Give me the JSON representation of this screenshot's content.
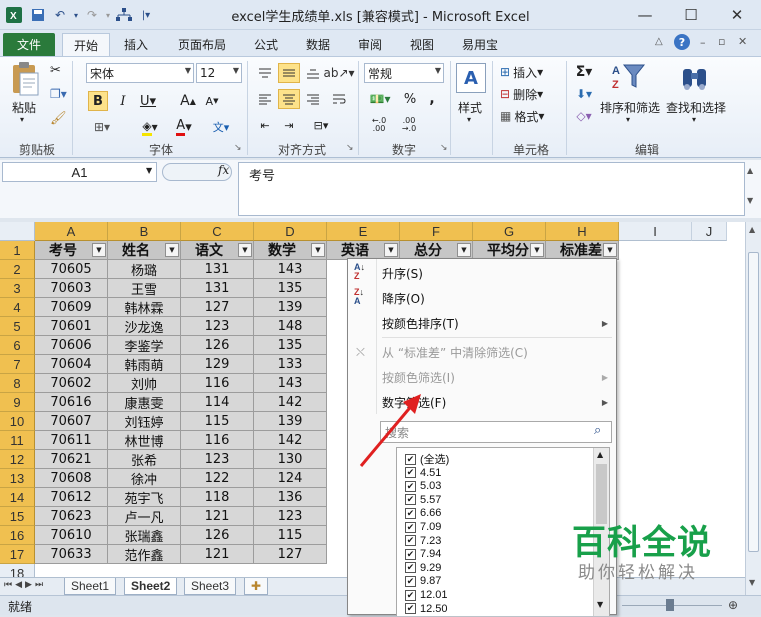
{
  "window": {
    "title": "excel学生成绩单.xls  [兼容模式] - Microsoft Excel",
    "minimize": "—",
    "maximize": "☐",
    "close": "✕"
  },
  "tabs": [
    "文件",
    "开始",
    "插入",
    "页面布局",
    "公式",
    "数据",
    "审阅",
    "视图",
    "易用宝"
  ],
  "ribbon": {
    "paste": "粘贴",
    "font_name": "宋体",
    "font_size": "12",
    "number_format": "常规",
    "style": "样式",
    "insert": "插入",
    "delete": "删除",
    "format": "格式",
    "sort_filter": "排序和筛选",
    "find_select": "查找和选择",
    "groups": [
      "剪贴板",
      "字体",
      "对齐方式",
      "数字",
      "单元格",
      "编辑"
    ]
  },
  "formula_bar": {
    "name_box": "A1",
    "fx": "fx",
    "content": "考号"
  },
  "grid": {
    "columns": [
      "A",
      "B",
      "C",
      "D",
      "E",
      "F",
      "G",
      "H",
      "I",
      "J"
    ],
    "row_numbers": [
      "1",
      "2",
      "3",
      "4",
      "5",
      "6",
      "7",
      "8",
      "9",
      "10",
      "11",
      "12",
      "13",
      "14",
      "15",
      "16",
      "17",
      "18"
    ],
    "headers": [
      "考号",
      "姓名",
      "语文",
      "数学",
      "英语",
      "总分",
      "平均分",
      "标准差"
    ],
    "rows": [
      [
        "70605",
        "杨璐",
        "131",
        "143"
      ],
      [
        "70603",
        "王雪",
        "131",
        "135"
      ],
      [
        "70609",
        "韩林霖",
        "127",
        "139"
      ],
      [
        "70601",
        "沙龙逸",
        "123",
        "148"
      ],
      [
        "70606",
        "李鉴学",
        "126",
        "135"
      ],
      [
        "70604",
        "韩雨萌",
        "129",
        "133"
      ],
      [
        "70602",
        "刘帅",
        "116",
        "143"
      ],
      [
        "70616",
        "康惠雯",
        "114",
        "142"
      ],
      [
        "70607",
        "刘钰婷",
        "115",
        "139"
      ],
      [
        "70611",
        "林世博",
        "116",
        "142"
      ],
      [
        "70621",
        "张希",
        "123",
        "130"
      ],
      [
        "70608",
        "徐冲",
        "122",
        "124"
      ],
      [
        "70612",
        "苑宇飞",
        "118",
        "136"
      ],
      [
        "70623",
        "卢一凡",
        "121",
        "123"
      ],
      [
        "70610",
        "张瑞鑫",
        "126",
        "115"
      ],
      [
        "70633",
        "范作鑫",
        "121",
        "127"
      ]
    ]
  },
  "sheets": [
    "Sheet1",
    "Sheet2",
    "Sheet3"
  ],
  "status": "就绪",
  "filter_menu": {
    "sort_asc": "升序(S)",
    "sort_desc": "降序(O)",
    "sort_color": "按颜色排序(T)",
    "clear_filter": "从 “标准差” 中清除筛选(C)",
    "color_filter": "按颜色筛选(I)",
    "number_filter": "数字筛选(F)",
    "search_placeholder": "搜索",
    "values": [
      "(全选)",
      "4.51",
      "5.03",
      "5.57",
      "6.66",
      "7.09",
      "7.23",
      "7.94",
      "9.29",
      "9.87",
      "12.01",
      "12.50"
    ]
  },
  "watermark": {
    "title": "百科全说",
    "subtitle": "助你轻松解决"
  },
  "colors": {
    "file_tab": "#2a7a3b",
    "header_highlight": "#f0c050",
    "watermark": "#18a04a",
    "arrow": "#e02020"
  }
}
